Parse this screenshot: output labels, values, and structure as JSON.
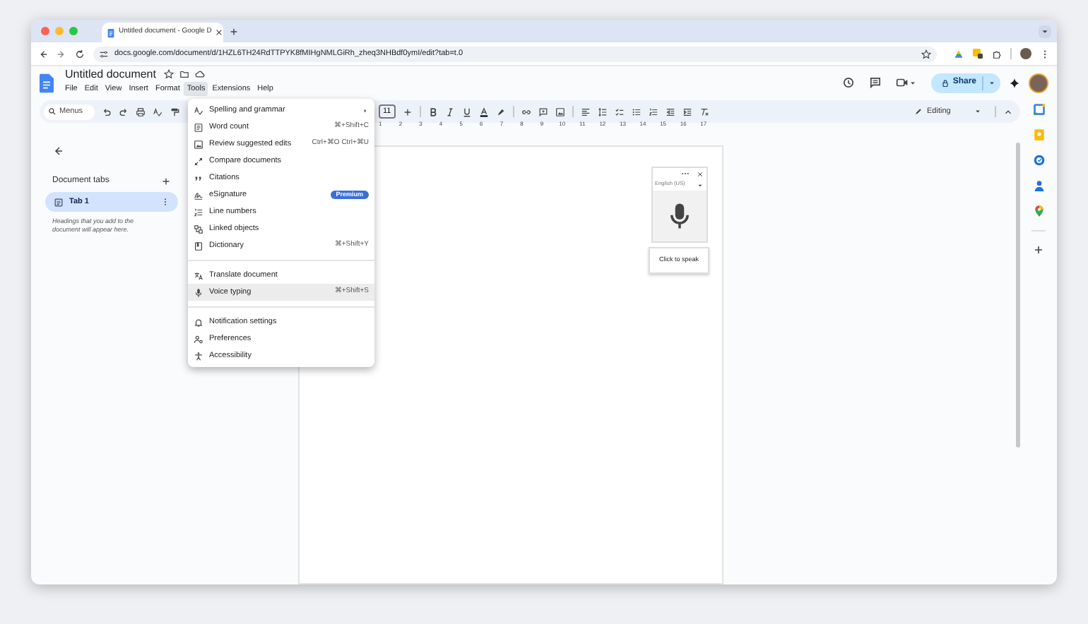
{
  "browser": {
    "tab_title": "Untitled document - Google D",
    "url": "docs.google.com/document/d/1HZL6TH24RdTTPYK8fMIHgNMLGiRh_zheq3NHBdf0ymI/edit?tab=t.0"
  },
  "document": {
    "title": "Untitled document",
    "menus": [
      {
        "label": "File",
        "selected": false
      },
      {
        "label": "Edit",
        "selected": false
      },
      {
        "label": "View",
        "selected": false
      },
      {
        "label": "Insert",
        "selected": false
      },
      {
        "label": "Format",
        "selected": false
      },
      {
        "label": "Tools",
        "selected": true
      },
      {
        "label": "Extensions",
        "selected": false
      },
      {
        "label": "Help",
        "selected": false
      }
    ],
    "share_label": "Share"
  },
  "toolbar": {
    "search_placeholder": "Menus",
    "font_size": "11",
    "mode": "Editing"
  },
  "ruler": [
    "1",
    "2",
    "3",
    "4",
    "5",
    "6",
    "7",
    "8",
    "9",
    "10",
    "11",
    "12",
    "13",
    "14",
    "15",
    "16",
    "17"
  ],
  "sidebar": {
    "heading": "Document tabs",
    "tabs": [
      {
        "label": "Tab 1",
        "selected": true
      }
    ],
    "hint": "Headings that you add to the document will appear here."
  },
  "tools_menu": [
    {
      "kind": "item",
      "label": "Spelling and grammar",
      "submenu": true,
      "selected": false
    },
    {
      "kind": "item",
      "label": "Word count",
      "shortcut": "⌘+Shift+C",
      "submenu": false,
      "selected": false
    },
    {
      "kind": "item",
      "label": "Review suggested edits",
      "shortcut": "Ctrl+⌘O Ctrl+⌘U",
      "submenu": false,
      "selected": false
    },
    {
      "kind": "item",
      "label": "Compare documents",
      "submenu": false,
      "selected": false
    },
    {
      "kind": "item",
      "label": "Citations",
      "submenu": false,
      "selected": false
    },
    {
      "kind": "item",
      "label": "eSignature",
      "badge": "Premium",
      "submenu": false,
      "selected": false
    },
    {
      "kind": "item",
      "label": "Line numbers",
      "submenu": false,
      "selected": false
    },
    {
      "kind": "item",
      "label": "Linked objects",
      "submenu": false,
      "selected": false
    },
    {
      "kind": "item",
      "label": "Dictionary",
      "shortcut": "⌘+Shift+Y",
      "submenu": false,
      "selected": false
    },
    {
      "kind": "separator"
    },
    {
      "kind": "item",
      "label": "Translate document",
      "submenu": false,
      "selected": false
    },
    {
      "kind": "item",
      "label": "Voice typing",
      "shortcut": "⌘+Shift+S",
      "submenu": false,
      "selected": true
    },
    {
      "kind": "separator"
    },
    {
      "kind": "item",
      "label": "Notification settings",
      "submenu": false,
      "selected": false
    },
    {
      "kind": "item",
      "label": "Preferences",
      "submenu": false,
      "selected": false
    },
    {
      "kind": "item",
      "label": "Accessibility",
      "submenu": false,
      "selected": false
    }
  ],
  "voice_typing": {
    "language": "English (US)",
    "tooltip": "Click to speak"
  }
}
